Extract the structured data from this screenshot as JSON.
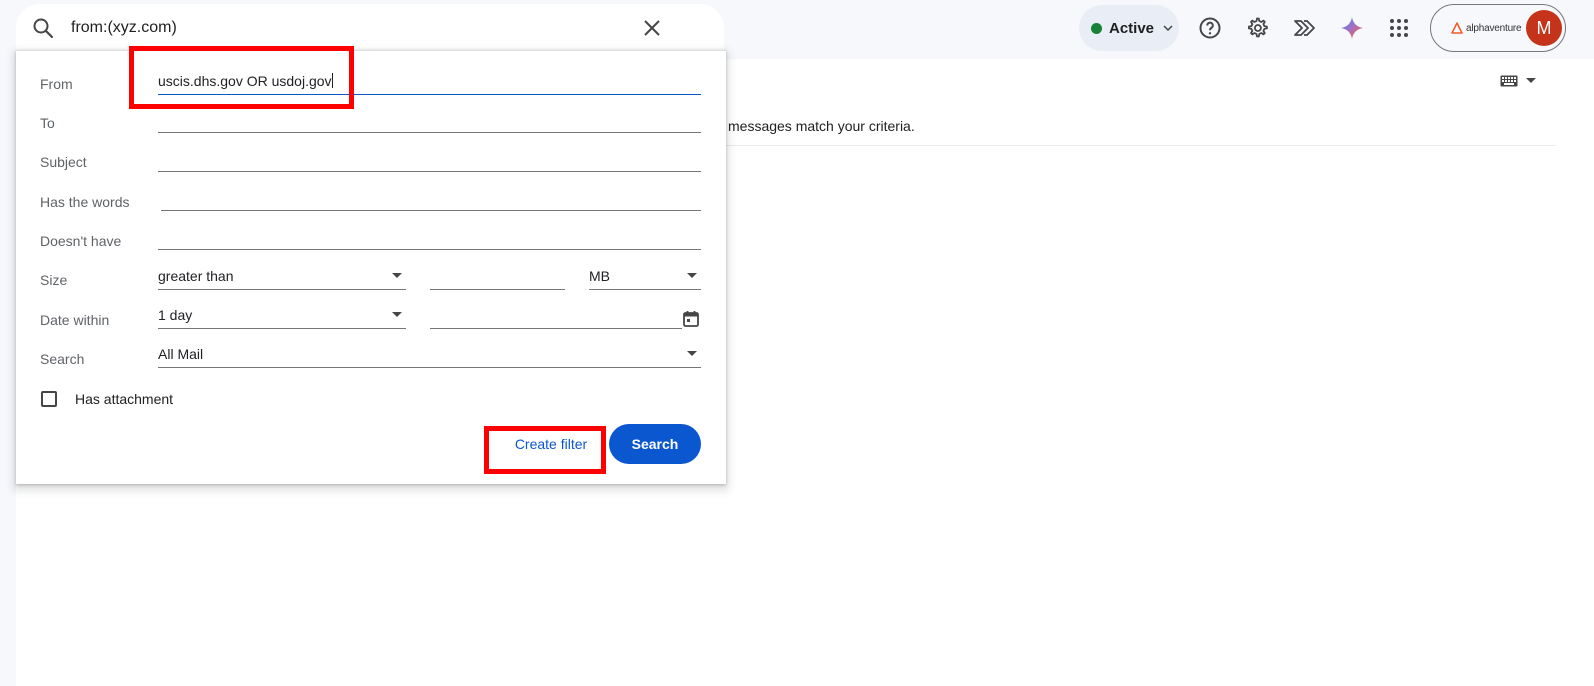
{
  "search": {
    "query": "from:(xyz.com)"
  },
  "header": {
    "status_label": "Active",
    "org_name": "alphaventure",
    "avatar_initial": "M",
    "status_color": "#188038",
    "accent_color": "#0b57d0"
  },
  "main": {
    "no_results_text": "messages match your criteria."
  },
  "advanced": {
    "from_label": "From",
    "from_value": "uscis.dhs.gov OR usdoj.gov",
    "to_label": "To",
    "to_value": "",
    "subject_label": "Subject",
    "subject_value": "",
    "has_words_label": "Has the words",
    "has_words_value": "",
    "doesnt_have_label": "Doesn't have",
    "doesnt_have_value": "",
    "size_label": "Size",
    "size_operator": "greater than",
    "size_value": "",
    "size_unit": "MB",
    "date_label": "Date within",
    "date_range": "1 day",
    "date_value": "",
    "search_label": "Search",
    "search_scope": "All Mail",
    "has_attachment_label": "Has attachment",
    "has_attachment_checked": false,
    "create_filter_label": "Create filter",
    "search_button_label": "Search"
  },
  "icons": {
    "search": "search-icon",
    "clear": "close-icon",
    "help": "help-icon",
    "settings": "gear-icon",
    "gemini_agent": "chevron-double-icon",
    "gemini": "gemini-sparkle-icon",
    "apps": "apps-grid-icon",
    "calendar": "calendar-icon",
    "keyboard": "keyboard-icon"
  }
}
